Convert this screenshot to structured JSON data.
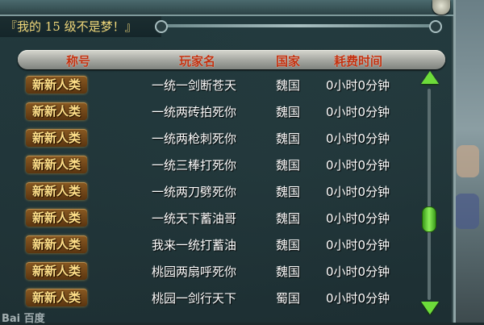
{
  "window": {
    "subtitle": "『我的 15 级不是梦！』"
  },
  "table": {
    "headers": [
      "称号",
      "玩家名",
      "国家",
      "耗费时间"
    ],
    "rows": [
      {
        "title": "新新人类",
        "player": "一统一剑断苍天",
        "country": "魏国",
        "time": "0小时0分钟"
      },
      {
        "title": "新新人类",
        "player": "一统两砖拍死你",
        "country": "魏国",
        "time": "0小时0分钟"
      },
      {
        "title": "新新人类",
        "player": "一统两枪刺死你",
        "country": "魏国",
        "time": "0小时0分钟"
      },
      {
        "title": "新新人类",
        "player": "一统三棒打死你",
        "country": "魏国",
        "time": "0小时0分钟"
      },
      {
        "title": "新新人类",
        "player": "一统两刀劈死你",
        "country": "魏国",
        "time": "0小时0分钟"
      },
      {
        "title": "新新人类",
        "player": "一统天下蓄油哥",
        "country": "魏国",
        "time": "0小时0分钟"
      },
      {
        "title": "新新人类",
        "player": "我来一统打蓄油",
        "country": "魏国",
        "time": "0小时0分钟"
      },
      {
        "title": "新新人类",
        "player": "桃园两扇呼死你",
        "country": "魏国",
        "time": "0小时0分钟"
      },
      {
        "title": "新新人类",
        "player": "桃园一剑行天下",
        "country": "蜀国",
        "time": "0小时0分钟"
      }
    ]
  },
  "scrollbar": {
    "position_fraction": 0.65
  },
  "colors": {
    "header_text": "#c2300e",
    "badge_text": "#ffe08a",
    "row_text": "#ffffff",
    "scroll_accent": "#6ddc3a"
  },
  "watermark": {
    "text": "Bai 百度"
  }
}
